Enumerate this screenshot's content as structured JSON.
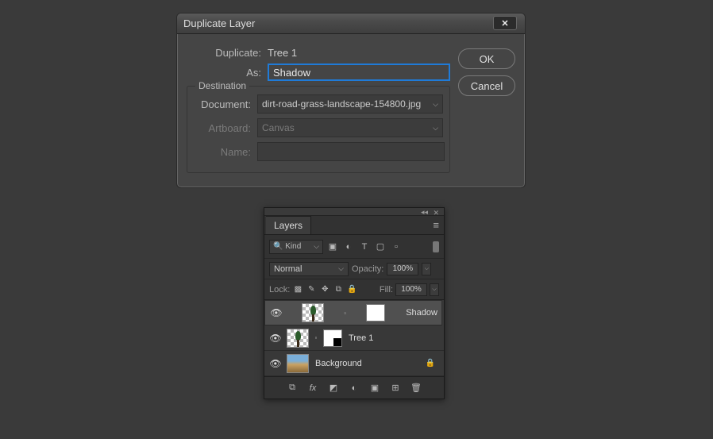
{
  "dialog": {
    "title": "Duplicate Layer",
    "duplicateLabel": "Duplicate:",
    "duplicateValue": "Tree 1",
    "asLabel": "As:",
    "asValue": "Shadow",
    "destTitle": "Destination",
    "documentLabel": "Document:",
    "documentValue": "dirt-road-grass-landscape-154800.jpg",
    "artboardLabel": "Artboard:",
    "artboardValue": "Canvas",
    "nameLabel": "Name:",
    "nameValue": "",
    "ok": "OK",
    "cancel": "Cancel"
  },
  "panel": {
    "tab": "Layers",
    "kindLabel": "Kind",
    "searchIcon": "🔍",
    "blendMode": "Normal",
    "opacityLabel": "Opacity:",
    "opacityValue": "100%",
    "lockLabel": "Lock:",
    "fillLabel": "Fill:",
    "fillValue": "100%",
    "layers": [
      {
        "name": "Shadow",
        "selected": true,
        "hasMask": true,
        "maskType": "full",
        "trans": true,
        "tree": true
      },
      {
        "name": "Tree 1",
        "selected": false,
        "hasMask": true,
        "maskType": "part",
        "trans": true,
        "tree": true
      },
      {
        "name": "Background",
        "selected": false,
        "locked": true,
        "bg": true
      }
    ]
  }
}
